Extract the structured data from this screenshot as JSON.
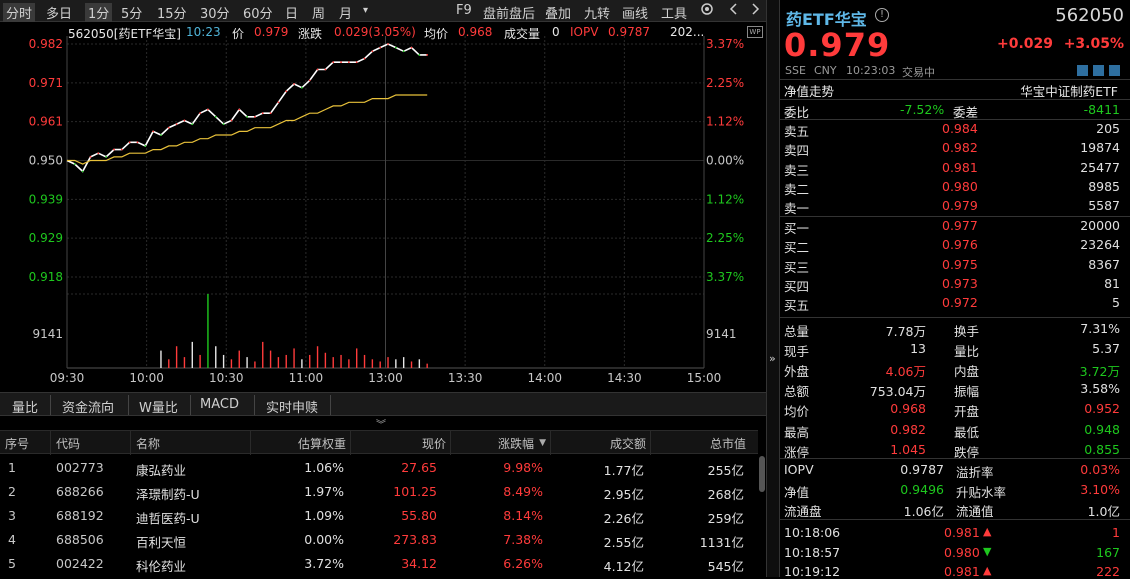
{
  "toolbar": {
    "periods": [
      "分时",
      "多日",
      "1分",
      "5分",
      "15分",
      "30分",
      "60分",
      "日",
      "周",
      "月"
    ],
    "more_icon": "▾",
    "right_items": [
      "F9",
      "盘前盘后",
      "叠加",
      "九转",
      "画线",
      "工具"
    ],
    "icons": [
      "gear-icon",
      "chevron-left-icon",
      "chevron-right-icon"
    ]
  },
  "chart": {
    "header": {
      "code_name": "562050[药ETF华宝]",
      "time": "10:23",
      "price_label": "价",
      "price": "0.979",
      "change_label": "涨跌",
      "change": "0.029(3.05%)",
      "avg_label": "均价",
      "avg": "0.968",
      "vol_label": "成交量",
      "vol": "0",
      "iopv_label": "IOPV",
      "iopv": "0.9787",
      "extra": "202..."
    },
    "wp_badge": "WP",
    "left_ticks": [
      "0.982",
      "0.971",
      "0.961",
      "0.950",
      "0.939",
      "0.929",
      "0.918",
      "9141"
    ],
    "right_ticks": [
      "3.37%",
      "2.25%",
      "1.12%",
      "0.00%",
      "1.12%",
      "2.25%",
      "3.37%",
      "9141"
    ],
    "time_ticks": [
      "09:30",
      "10:00",
      "10:30",
      "11:00",
      "13:00",
      "13:30",
      "14:00",
      "14:30",
      "15:00"
    ]
  },
  "chart_data": {
    "type": "line",
    "title": "",
    "xlabel": "",
    "ylabel": "",
    "ylim": [
      0.918,
      0.982
    ],
    "prev_close": 0.95,
    "series": [
      {
        "name": "价",
        "values": [
          0.95,
          0.949,
          0.947,
          0.951,
          0.952,
          0.951,
          0.953,
          0.953,
          0.955,
          0.955,
          0.954,
          0.958,
          0.957,
          0.959,
          0.96,
          0.961,
          0.96,
          0.963,
          0.964,
          0.962,
          0.96,
          0.961,
          0.964,
          0.962,
          0.962,
          0.963,
          0.963,
          0.966,
          0.969,
          0.971,
          0.97,
          0.972,
          0.975,
          0.975,
          0.977,
          0.977,
          0.977,
          0.977,
          0.978,
          0.98,
          0.981,
          0.982,
          0.981,
          0.98,
          0.981,
          0.979,
          0.979
        ]
      },
      {
        "name": "均价",
        "values": [
          0.95,
          0.95,
          0.949,
          0.95,
          0.95,
          0.95,
          0.951,
          0.951,
          0.952,
          0.952,
          0.952,
          0.953,
          0.953,
          0.954,
          0.954,
          0.955,
          0.955,
          0.956,
          0.956,
          0.957,
          0.957,
          0.957,
          0.958,
          0.958,
          0.959,
          0.959,
          0.959,
          0.96,
          0.961,
          0.961,
          0.962,
          0.963,
          0.963,
          0.964,
          0.965,
          0.965,
          0.966,
          0.966,
          0.966,
          0.967,
          0.967,
          0.967,
          0.968,
          0.968,
          0.968,
          0.968,
          0.968
        ]
      }
    ],
    "volume": [
      0,
      0,
      0,
      0,
      0,
      0,
      0,
      0,
      0,
      0,
      0,
      0,
      0.8,
      0.4,
      1.0,
      0.5,
      1.2,
      0.6,
      3.4,
      1.0,
      0.6,
      0.4,
      0.8,
      0.5,
      0.3,
      1.2,
      0.8,
      0.5,
      0.6,
      0.9,
      0.4,
      0.6,
      1.0,
      0.7,
      0.5,
      0.6,
      0.4,
      0.9,
      0.6,
      0.4,
      0.3,
      0.5,
      0.4,
      0.5,
      0.3,
      0.4,
      0.2
    ]
  },
  "lower_tabs": [
    "量比",
    "资金流向",
    "W量比",
    "MACD",
    "实时申赎"
  ],
  "table": {
    "headers": [
      "序号",
      "代码",
      "名称",
      "估算权重",
      "现价",
      "涨跌幅",
      "成交额",
      "总市值"
    ],
    "sort_icon": "▼",
    "rows": [
      {
        "idx": "1",
        "code": "002773",
        "name": "康弘药业",
        "weight": "1.06%",
        "price": "27.65",
        "chg": "9.98%",
        "amount": "1.77亿",
        "cap": "255亿"
      },
      {
        "idx": "2",
        "code": "688266",
        "name": "泽璟制药-U",
        "weight": "1.97%",
        "price": "101.25",
        "chg": "8.49%",
        "amount": "2.95亿",
        "cap": "268亿"
      },
      {
        "idx": "3",
        "code": "688192",
        "name": "迪哲医药-U",
        "weight": "1.09%",
        "price": "55.80",
        "chg": "8.14%",
        "amount": "2.26亿",
        "cap": "259亿"
      },
      {
        "idx": "4",
        "code": "688506",
        "name": "百利天恒",
        "weight": "0.00%",
        "price": "273.83",
        "chg": "7.38%",
        "amount": "2.55亿",
        "cap": "1131亿"
      },
      {
        "idx": "5",
        "code": "002422",
        "name": "科伦药业",
        "weight": "3.72%",
        "price": "34.12",
        "chg": "6.26%",
        "amount": "4.12亿",
        "cap": "545亿"
      }
    ]
  },
  "quote": {
    "name": "药ETF华宝",
    "code": "562050",
    "price": "0.979",
    "change": "+0.029",
    "change_pct": "+3.05%",
    "exchange": "SSE",
    "currency": "CNY",
    "time": "10:23:03",
    "status": "交易中",
    "nav_trend": "净值走势",
    "index_name": "华宝中证制药ETF",
    "ratio_label": "委比",
    "ratio": "-7.52%",
    "diff_label": "委差",
    "diff": "-8411",
    "asks": [
      {
        "label": "卖五",
        "price": "0.984",
        "vol": "205"
      },
      {
        "label": "卖四",
        "price": "0.982",
        "vol": "19874"
      },
      {
        "label": "卖三",
        "price": "0.981",
        "vol": "25477"
      },
      {
        "label": "卖二",
        "price": "0.980",
        "vol": "8985"
      },
      {
        "label": "卖一",
        "price": "0.979",
        "vol": "5587"
      }
    ],
    "bids": [
      {
        "label": "买一",
        "price": "0.977",
        "vol": "20000"
      },
      {
        "label": "买二",
        "price": "0.976",
        "vol": "23264"
      },
      {
        "label": "买三",
        "price": "0.975",
        "vol": "8367"
      },
      {
        "label": "买四",
        "price": "0.973",
        "vol": "81"
      },
      {
        "label": "买五",
        "price": "0.972",
        "vol": "5"
      }
    ],
    "stats": [
      {
        "l1": "总量",
        "v1": "7.78万",
        "l2": "换手",
        "v2": "7.31%"
      },
      {
        "l1": "现手",
        "v1": "13",
        "l2": "量比",
        "v2": "5.37"
      },
      {
        "l1": "外盘",
        "v1": "4.06万",
        "l2": "内盘",
        "v2": "3.72万"
      },
      {
        "l1": "总额",
        "v1": "753.04万",
        "l2": "振幅",
        "v2": "3.58%"
      },
      {
        "l1": "均价",
        "v1": "0.968",
        "l2": "开盘",
        "v2": "0.952"
      },
      {
        "l1": "最高",
        "v1": "0.982",
        "l2": "最低",
        "v2": "0.948"
      },
      {
        "l1": "涨停",
        "v1": "1.045",
        "l2": "跌停",
        "v2": "0.855"
      }
    ],
    "stats2": [
      {
        "l1": "IOPV",
        "v1": "0.9787",
        "l2": "溢折率",
        "v2": "0.03%"
      },
      {
        "l1": "净值",
        "v1": "0.9496",
        "l2": "升贴水率",
        "v2": "3.10%"
      },
      {
        "l1": "流通盘",
        "v1": "1.06亿",
        "l2": "流通值",
        "v2": "1.0亿"
      }
    ],
    "ticks": [
      {
        "time": "10:18:06",
        "price": "0.981",
        "vol": "1",
        "dir": "up"
      },
      {
        "time": "10:18:57",
        "price": "0.980",
        "vol": "167",
        "dir": "down"
      },
      {
        "time": "10:19:12",
        "price": "0.981",
        "vol": "222",
        "dir": "up"
      }
    ]
  },
  "colors": {
    "up": "#ff3b3b",
    "down": "#1ec81e",
    "price_line": "#ffffff",
    "avg_line": "#e8c13a",
    "grid": "#2a2a2a"
  }
}
